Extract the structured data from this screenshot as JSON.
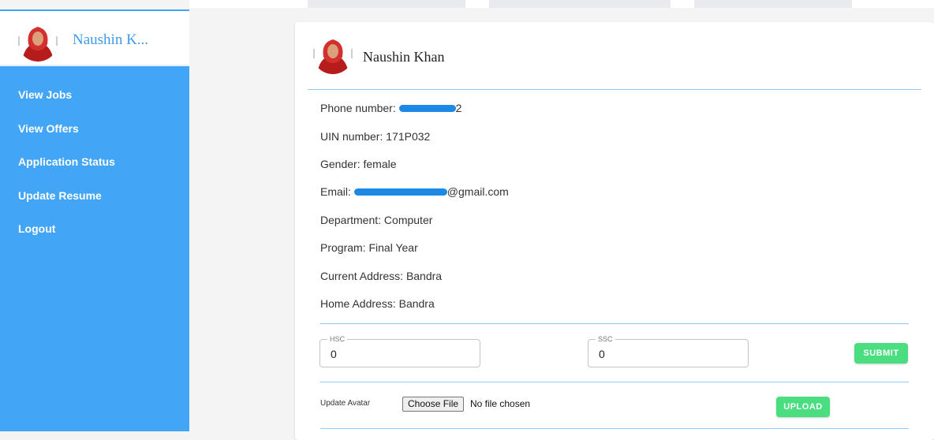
{
  "sidebar": {
    "user_name": "Naushin K...",
    "nav": [
      {
        "label": "View Jobs"
      },
      {
        "label": "View Offers"
      },
      {
        "label": "Application Status"
      },
      {
        "label": "Update Resume"
      },
      {
        "label": "Logout"
      }
    ]
  },
  "profile": {
    "name": "Naushin Khan",
    "phone_label": "Phone number:",
    "phone_tail": "2",
    "uin": "UIN number: 171P032",
    "gender": "Gender: female",
    "email_label": "Email:",
    "email_tail": "@gmail.com",
    "department": "Department: Computer",
    "program": "Program: Final Year",
    "current_address": "Current Address: Bandra",
    "home_address": "Home Address: Bandra"
  },
  "marks": {
    "hsc_label": "HSC",
    "hsc_value": "0",
    "ssc_label": "SSC",
    "ssc_value": "0",
    "submit_label": "SUBMIT"
  },
  "avatar_upload": {
    "label": "Update Avatar",
    "choose_label": "Choose File",
    "file_status": "No file chosen",
    "upload_label": "UPLOAD"
  },
  "colors": {
    "sidebar_bg": "#42a5f5",
    "accent_green": "#4ade80",
    "redaction_blue": "#1e88e5",
    "headscarf_red": "#d32f2f"
  }
}
